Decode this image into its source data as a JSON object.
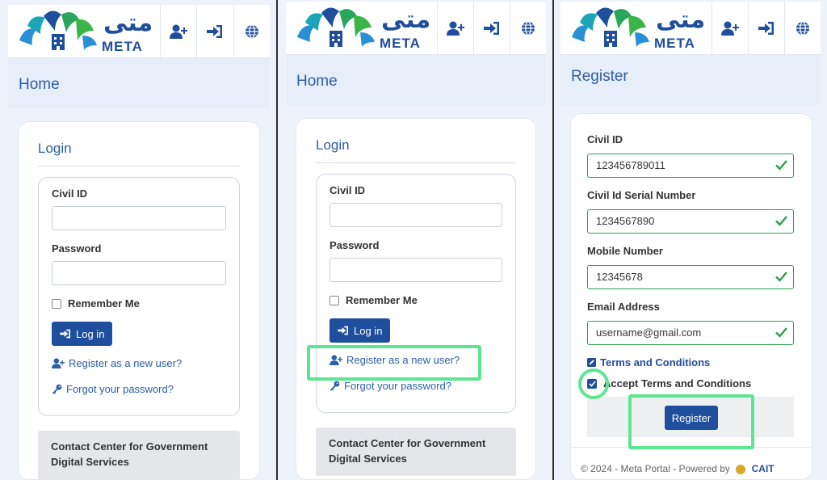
{
  "brand": {
    "arabic": "متى",
    "latin": "META"
  },
  "toolbar_icons": [
    "add-user-icon",
    "sign-in-icon",
    "globe-icon"
  ],
  "colors": {
    "primary": "#1f4e9c",
    "link": "#2d5ea8",
    "valid": "#2e9e4f",
    "highlight": "#5de593"
  },
  "screens": [
    {
      "page_title": "Home",
      "login": {
        "title": "Login",
        "civil_id_label": "Civil ID",
        "password_label": "Password",
        "remember_label": "Remember Me",
        "login_button": "Log in",
        "register_link": "Register as a new user?",
        "forgot_link": "Forgot your password?"
      },
      "contact": {
        "line1": "Contact Center for Government",
        "line2": "Digital Services"
      }
    },
    {
      "page_title": "Home",
      "login": {
        "title": "Login",
        "civil_id_label": "Civil ID",
        "password_label": "Password",
        "remember_label": "Remember Me",
        "login_button": "Log in",
        "register_link": "Register as a new user?",
        "forgot_link": "Forgot your password?"
      },
      "contact": {
        "line1": "Contact Center for Government",
        "line2": "Digital Services"
      }
    },
    {
      "page_title": "Register",
      "fields": [
        {
          "label": "Civil ID",
          "value": "123456789011"
        },
        {
          "label": "Civil Id Serial Number",
          "value": "1234567890"
        },
        {
          "label": "Mobile Number",
          "value": "12345678"
        },
        {
          "label": "Email Address",
          "value": "username@gmail.com"
        }
      ],
      "terms_link": "Terms and Conditions",
      "accept_label": "Accept Terms and Conditions",
      "accept_checked": true,
      "register_button": "Register",
      "footer": "© 2024 - Meta Portal - Powered by",
      "footer_org": "CAIT"
    }
  ]
}
